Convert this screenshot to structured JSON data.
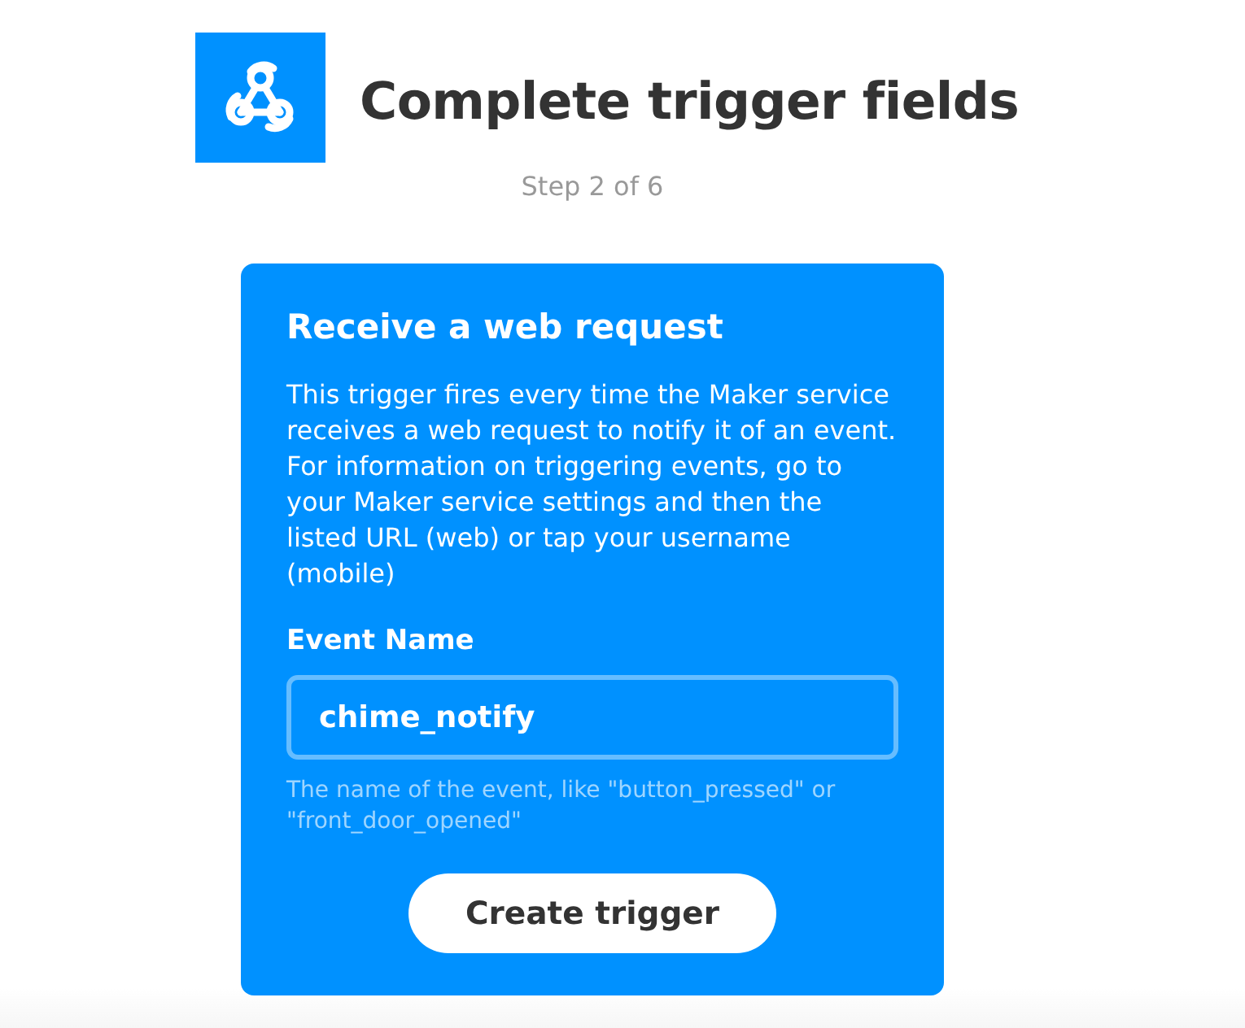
{
  "header": {
    "title": "Complete trigger fields",
    "step": "Step 2 of 6"
  },
  "trigger": {
    "title": "Receive a web request",
    "description": "This trigger fires every time the Maker service receives a web request to notify it of an event. For information on triggering events, go to your Maker service settings and then the listed URL (web) or tap your username (mobile)",
    "fields": [
      {
        "label": "Event Name",
        "value": "chime_notify",
        "hint": "The name of the event, like \"button_pressed\" or \"front_door_opened\""
      }
    ],
    "button": "Create trigger"
  }
}
